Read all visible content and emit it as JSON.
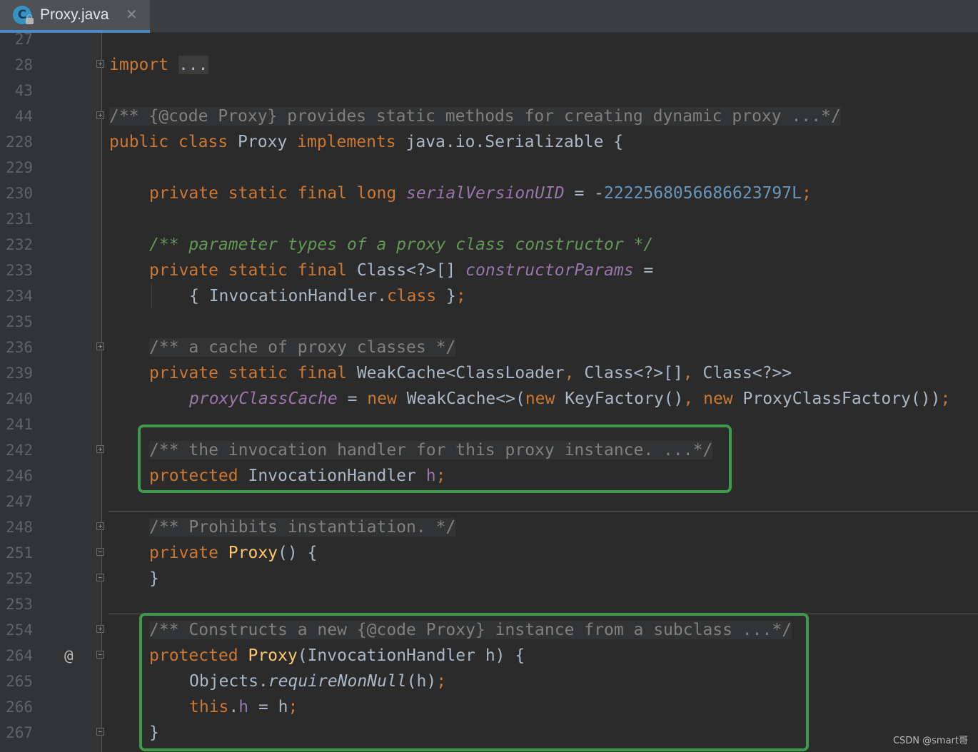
{
  "tab": {
    "title": "Proxy.java",
    "icon_letter": "C",
    "close": "✕"
  },
  "lines": [
    {
      "n": "27"
    },
    {
      "n": "28",
      "import_kw": "import",
      "import_dots": "..."
    },
    {
      "n": "43"
    },
    {
      "n": "44",
      "text": "/** {@code Proxy} provides static methods for creating dynamic proxy ...*/"
    },
    {
      "n": "228",
      "kw1": "public class",
      "name": "Proxy",
      "kw2": "implements",
      "iface": "java.io.Serializable {"
    },
    {
      "n": "229"
    },
    {
      "n": "230",
      "kw": "private static final long",
      "field": "serialVersionUID",
      "eq": " = -",
      "value": "2222568056686623797L",
      "semi": ";"
    },
    {
      "n": "231"
    },
    {
      "n": "232",
      "text": "/** parameter types of a proxy class constructor */"
    },
    {
      "n": "233",
      "kw": "private static final",
      "type": "Class<?>[]",
      "field": "constructorParams",
      "eq": " ="
    },
    {
      "n": "234",
      "open": "{ InvocationHandler.",
      "kw": "class",
      "close": " }",
      "semi": ";"
    },
    {
      "n": "235"
    },
    {
      "n": "236",
      "text": "/** a cache of proxy classes */"
    },
    {
      "n": "239",
      "kw": "private static final",
      "type1": "WeakCache<ClassLoader",
      "comma1": ",",
      "type2": " Class<?>[]",
      "comma2": ",",
      "type3": " Class<?>>"
    },
    {
      "n": "240",
      "field": "proxyClassCache",
      "eq": " = ",
      "new1": "new",
      "t1": " WeakCache<>(",
      "new2": "new",
      "t2": " KeyFactory()",
      "comma": ",",
      "new3": "new",
      "t3": " ProxyClassFactory())",
      "semi": ";"
    },
    {
      "n": "241"
    },
    {
      "n": "242",
      "text": "/** the invocation handler for this proxy instance. ...*/"
    },
    {
      "n": "246",
      "kw": "protected",
      "type": " InvocationHandler ",
      "field": "h",
      "semi": ";"
    },
    {
      "n": "247"
    },
    {
      "n": "248",
      "text": "/** Prohibits instantiation. */"
    },
    {
      "n": "251",
      "kw": "private",
      "name": "Proxy",
      "rest": "() {"
    },
    {
      "n": "252",
      "close": "}"
    },
    {
      "n": "253"
    },
    {
      "n": "254",
      "text": "/** Constructs a new {@code Proxy} instance from a subclass ...*/"
    },
    {
      "n": "264",
      "mark": "@",
      "kw": "protected",
      "name": "Proxy",
      "rest": "(InvocationHandler h) {"
    },
    {
      "n": "265",
      "obj": "Objects.",
      "method": "requireNonNull",
      "args": "(h)",
      "semi": ";"
    },
    {
      "n": "266",
      "kw": "this",
      "dot": ".",
      "field": "h",
      "rest": " = h",
      "semi": ";"
    },
    {
      "n": "267",
      "close": "}"
    }
  ],
  "watermark": "CSDN @smart哥",
  "colors": {
    "keyword": "#cc7832",
    "comment": "#808080",
    "doc_comment": "#629755",
    "field": "#9876aa",
    "number": "#6897bb",
    "method": "#ffc66d",
    "highlight_box": "#3d9a4a"
  }
}
